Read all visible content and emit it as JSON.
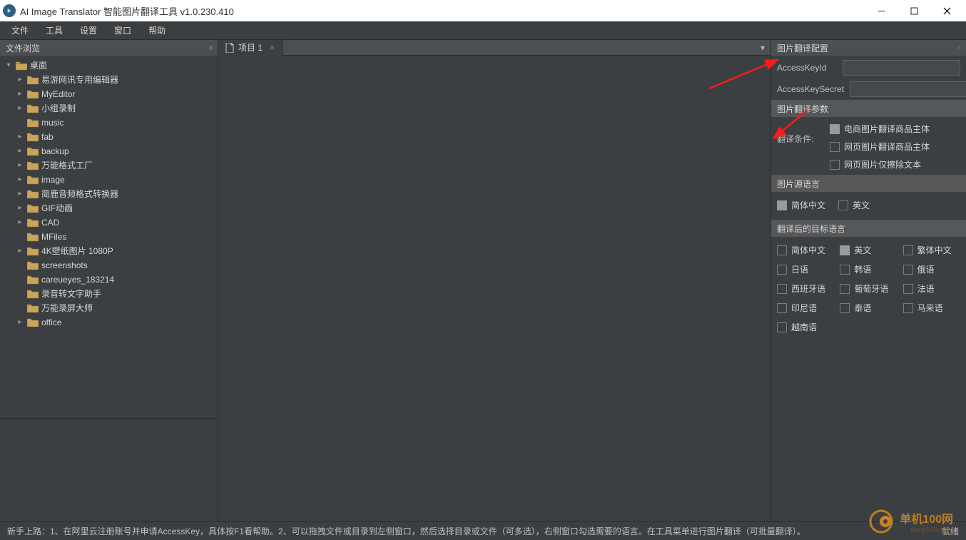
{
  "window": {
    "title": "AI Image Translator 智能图片翻译工具 v1.0.230.410"
  },
  "menu": {
    "items": [
      "文件",
      "工具",
      "设置",
      "窗口",
      "帮助"
    ]
  },
  "file_browser": {
    "title": "文件浏览",
    "root": "桌面",
    "items": [
      "易游网讯专用编辑器",
      "MyEditor",
      "小组录制",
      "music",
      "fab",
      "backup",
      "万能格式工厂",
      "image",
      "简鹿音频格式转换器",
      "GIF动画",
      "CAD",
      "MFiles",
      "4K壁纸图片 1080P",
      "screenshots",
      "careueyes_183214",
      "录音转文字助手",
      "万能录屏大师",
      "office"
    ],
    "expandable": [
      true,
      true,
      true,
      false,
      true,
      true,
      true,
      true,
      true,
      true,
      true,
      false,
      true,
      false,
      false,
      false,
      false,
      true
    ]
  },
  "tabs": {
    "items": [
      {
        "label": "项目 1"
      }
    ]
  },
  "config_panel": {
    "title": "图片翻译配置",
    "access_key_id_label": "AccessKeyId",
    "access_key_id_value": "",
    "access_key_secret_label": "AccessKeySecret",
    "access_key_secret_value": "",
    "params_section": "图片翻译参数",
    "condition_label": "翻译条件:",
    "conditions": [
      {
        "label": "电商图片翻译商品主体",
        "checked": true
      },
      {
        "label": "网页图片翻译商品主体",
        "checked": false
      },
      {
        "label": "网页图片仅擦除文本",
        "checked": false
      }
    ],
    "source_lang_section": "图片源语言",
    "source_langs": [
      {
        "label": "简体中文",
        "checked": true
      },
      {
        "label": "英文",
        "checked": false
      }
    ],
    "target_section": "翻译后的目标语言",
    "target_langs": [
      {
        "label": "简体中文",
        "checked": false
      },
      {
        "label": "英文",
        "checked": true
      },
      {
        "label": "繁体中文",
        "checked": false
      },
      {
        "label": "日语",
        "checked": false
      },
      {
        "label": "韩语",
        "checked": false
      },
      {
        "label": "俄语",
        "checked": false
      },
      {
        "label": "西班牙语",
        "checked": false
      },
      {
        "label": "葡萄牙语",
        "checked": false
      },
      {
        "label": "法语",
        "checked": false
      },
      {
        "label": "印尼语",
        "checked": false
      },
      {
        "label": "泰语",
        "checked": false
      },
      {
        "label": "马来语",
        "checked": false
      },
      {
        "label": "越南语",
        "checked": false
      }
    ]
  },
  "statusbar": {
    "hint": "新手上路：1、在阿里云注册账号并申请AccessKey，具体按F1看帮助。2、可以拖拽文件或目录到左侧窗口，然后选择目录或文件（可多选），右侧窗口勾选需要的语言。在工具菜单进行图片翻译（可批量翻译）。",
    "status": "就绪"
  },
  "watermark": {
    "name": "单机100网",
    "sub": "danji100.com"
  }
}
